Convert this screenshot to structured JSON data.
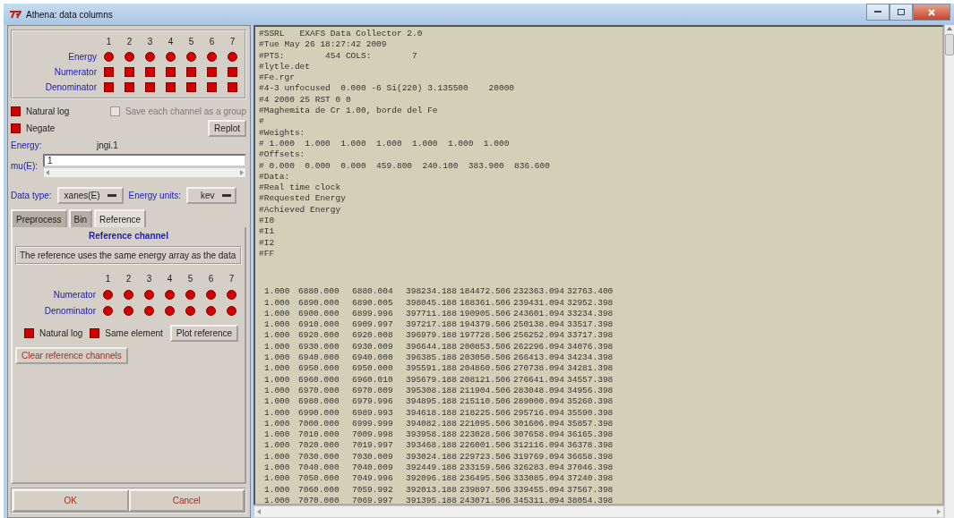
{
  "window": {
    "title": "Athena: data columns"
  },
  "columns": {
    "numbers": [
      "1",
      "2",
      "3",
      "4",
      "5",
      "6",
      "7"
    ],
    "rows": [
      {
        "label": "Energy",
        "kind": "radio",
        "states": [
          true,
          true,
          true,
          true,
          true,
          true,
          true
        ]
      },
      {
        "label": "Numerator",
        "kind": "check",
        "states": [
          true,
          true,
          true,
          true,
          true,
          true,
          true
        ]
      },
      {
        "label": "Denominator",
        "kind": "check",
        "states": [
          true,
          true,
          true,
          true,
          true,
          true,
          true
        ]
      }
    ]
  },
  "options": [
    {
      "label": "Natural log",
      "checked": true,
      "disabled": false
    },
    {
      "label": "Save each channel as a group",
      "checked": false,
      "disabled": true
    },
    {
      "label": "Negate",
      "checked": true,
      "disabled": false
    }
  ],
  "replot_button": "Replot",
  "energy": {
    "label": "Energy:",
    "value": "jngi.1"
  },
  "mu": {
    "label": "mu(E):",
    "value": "1"
  },
  "data_type": {
    "label": "Data type:",
    "value": "xanes(E)"
  },
  "energy_units": {
    "label": "Energy units:",
    "value": "kev"
  },
  "tabs": [
    {
      "label": "Preprocess",
      "selected": false
    },
    {
      "label": "Bin",
      "selected": false
    },
    {
      "label": "Reference",
      "selected": true
    }
  ],
  "reference": {
    "title": "Reference channel",
    "note": "The reference uses the same energy array as the data",
    "numbers": [
      "1",
      "2",
      "3",
      "4",
      "5",
      "6",
      "7"
    ],
    "rows": [
      {
        "label": "Numerator",
        "kind": "radio",
        "states": [
          true,
          true,
          true,
          true,
          true,
          true,
          true
        ]
      },
      {
        "label": "Denominator",
        "kind": "radio",
        "states": [
          true,
          true,
          true,
          true,
          true,
          true,
          true
        ]
      }
    ],
    "options": [
      {
        "label": "Natural log",
        "checked": true
      },
      {
        "label": "Same element",
        "checked": true
      }
    ],
    "plot_button": "Plot reference",
    "clear_button": "Clear reference channels"
  },
  "buttons": [
    "OK",
    "Cancel"
  ],
  "file_header": [
    "#SSRL   EXAFS Data Collector 2.0",
    "#Tue May 26 18:27:42 2009",
    "#PTS:        454 COLS:        7",
    "#lytle.det",
    "#Fe.rgr",
    "#4-3 unfocused  0.000 -6 Si(220) 3.135500    20000",
    "#4 2000 25 RST 0 0",
    "#Maghemita de Cr 1.00, borde del Fe",
    "#",
    "#Weights:",
    "# 1.000  1.000  1.000  1.000  1.000  1.000  1.000",
    "#Offsets:",
    "# 0.000  0.000  0.000  459.800  240.100  383.900  836.600",
    "#Data:",
    "#Real time clock",
    "#Requested Energy",
    "#Achieved Energy",
    "#I0",
    "#I1",
    "#I2",
    "#FF"
  ],
  "file_rows": [
    [
      "1.000",
      "6880.000",
      "6880.004",
      "398234.188",
      "184472.506",
      "232363.094",
      "32763.400"
    ],
    [
      "1.000",
      "6890.000",
      "6890.005",
      "398045.188",
      "188361.506",
      "239431.094",
      "32952.398"
    ],
    [
      "1.000",
      "6900.000",
      "6899.996",
      "397711.188",
      "190905.506",
      "243601.094",
      "33234.398"
    ],
    [
      "1.000",
      "6910.000",
      "6909.997",
      "397217.188",
      "194379.506",
      "250138.094",
      "33517.398"
    ],
    [
      "1.000",
      "6920.000",
      "6920.008",
      "396979.188",
      "197728.506",
      "256252.094",
      "33717.398"
    ],
    [
      "1.000",
      "6930.000",
      "6930.009",
      "396644.188",
      "200853.506",
      "262296.094",
      "34076.398"
    ],
    [
      "1.000",
      "6940.000",
      "6940.000",
      "396385.188",
      "203050.506",
      "266413.094",
      "34234.398"
    ],
    [
      "1.000",
      "6950.000",
      "6950.000",
      "395591.188",
      "204860.506",
      "270738.094",
      "34281.398"
    ],
    [
      "1.000",
      "6960.000",
      "6960.010",
      "395679.188",
      "208121.506",
      "276641.094",
      "34557.398"
    ],
    [
      "1.000",
      "6970.000",
      "6970.009",
      "395308.188",
      "211904.506",
      "283048.094",
      "34956.398"
    ],
    [
      "1.000",
      "6980.000",
      "6979.996",
      "394895.188",
      "215110.506",
      "289000.094",
      "35260.398"
    ],
    [
      "1.000",
      "6990.000",
      "6989.993",
      "394618.188",
      "218225.506",
      "295716.094",
      "35590.398"
    ],
    [
      "1.000",
      "7000.000",
      "6999.999",
      "394082.188",
      "221095.506",
      "301606.094",
      "35857.398"
    ],
    [
      "1.000",
      "7010.000",
      "7009.998",
      "393958.188",
      "223028.506",
      "307658.094",
      "36165.398"
    ],
    [
      "1.000",
      "7020.000",
      "7019.997",
      "393468.188",
      "226001.506",
      "312116.094",
      "36378.398"
    ],
    [
      "1.000",
      "7030.000",
      "7030.009",
      "393024.188",
      "229723.506",
      "319769.094",
      "36658.398"
    ],
    [
      "1.000",
      "7040.000",
      "7040.009",
      "392449.188",
      "233159.506",
      "326283.094",
      "37046.398"
    ],
    [
      "1.000",
      "7050.000",
      "7049.996",
      "392096.188",
      "236495.506",
      "333085.094",
      "37240.398"
    ],
    [
      "1.000",
      "7060.000",
      "7059.992",
      "392013.188",
      "239897.506",
      "339455.094",
      "37567.398"
    ],
    [
      "1.000",
      "7070.000",
      "7069.997",
      "391395.188",
      "243071.506",
      "345311.094",
      "38054.398"
    ]
  ]
}
